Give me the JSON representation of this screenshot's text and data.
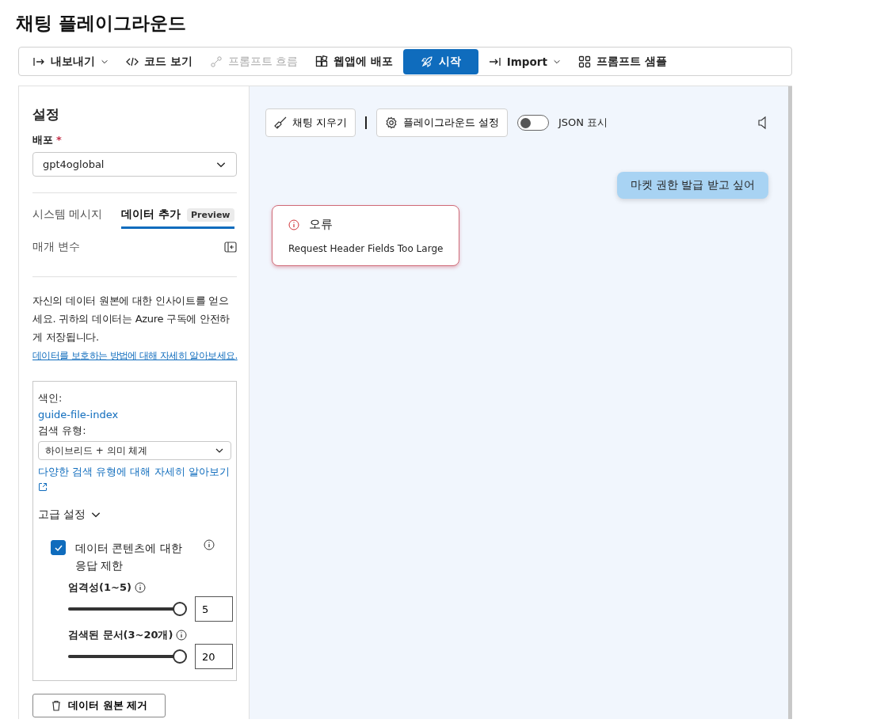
{
  "page_title": "채팅 플레이그라운드",
  "toolbar": [
    {
      "label": "내보내기",
      "kind": "button",
      "disabled": false,
      "dropdown": true
    },
    {
      "label": "코드 보기",
      "kind": "button",
      "disabled": false,
      "dropdown": false
    },
    {
      "label": "프롬프트 흐름",
      "kind": "button",
      "disabled": true,
      "dropdown": false
    },
    {
      "label": "웹앱에 배포",
      "kind": "button",
      "disabled": false,
      "dropdown": false
    },
    {
      "label": "시작",
      "kind": "primary",
      "disabled": false,
      "dropdown": false
    },
    {
      "label": "Import",
      "kind": "button",
      "disabled": false,
      "dropdown": true
    },
    {
      "label": "프롬프트 샘플",
      "kind": "button",
      "disabled": false,
      "dropdown": false
    }
  ],
  "settings": {
    "title": "설정",
    "deployment_label": "배포",
    "required_mark": "*",
    "deployment_value": "gpt4oglobal",
    "tabs": [
      {
        "label": "시스템 메시지",
        "selected": false
      },
      {
        "label": "데이터 추가",
        "selected": true,
        "badge": "Preview"
      }
    ],
    "parameters_label": "매개 변수",
    "description": "자신의 데이터 원본에 대한 인사이트를 얻으세요. 귀하의 데이터는 Azure 구독에 안전하게 저장됩니다.",
    "description_link": "데이터를 보호하는 방법에 대해 자세히 알아보세요.",
    "index_label": "색인:",
    "index_value": "guide-file-index",
    "search_type_label": "검색 유형:",
    "search_type_value": "하이브리드 + 의미 체계",
    "search_type_link": "다양한 검색 유형에 대해 자세히 알아보기",
    "advanced_label": "고급 설정",
    "advanced_expanded": true,
    "limit_checkbox": {
      "label": "데이터 콘텐츠에 대한 응답 제한",
      "checked": true
    },
    "sliders": [
      {
        "label": "엄격성(1~5)",
        "level": 1,
        "value": "5"
      },
      {
        "label": "검색된 문서(3~20개)",
        "level": 1,
        "value": "20"
      }
    ],
    "remove_button": "데이터 원본 제거"
  },
  "chat": {
    "clear_button": "채팅 지우기",
    "settings_button": "플레이그라운드 설정",
    "json_toggle": {
      "label": "JSON 표시",
      "on": false
    },
    "messages": [
      {
        "kind": "user",
        "text": "마켓 권한 발급 받고 싶어"
      },
      {
        "kind": "error",
        "title": "오류",
        "text": "Request Header Fields Too Large"
      }
    ]
  }
}
